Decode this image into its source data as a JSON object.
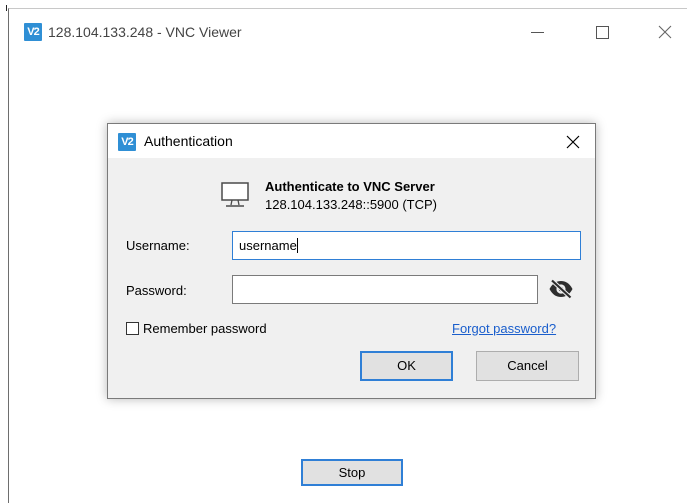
{
  "window": {
    "title": "128.104.133.248 - VNC Viewer",
    "logo_text": "V2"
  },
  "dialog": {
    "title": "Authentication",
    "logo_text": "V2",
    "heading": "Authenticate to VNC Server",
    "server_address": "128.104.133.248::5900 (TCP)",
    "username_label": "Username:",
    "username_value": "username",
    "password_label": "Password:",
    "password_value": "",
    "remember_label": "Remember password",
    "remember_checked": false,
    "forgot_link": "Forgot password?",
    "ok_label": "OK",
    "cancel_label": "Cancel"
  },
  "footer": {
    "stop_label": "Stop"
  },
  "icons": {
    "logo": "vnc-logo-icon",
    "monitor": "monitor-icon",
    "toggle_visibility": "eye-slash-icon",
    "close": "close-icon"
  },
  "colors": {
    "brand": "#2f8fd5",
    "focus": "#2f7fd6",
    "link": "#1a5ecc",
    "dialog_bg": "#f0f0f0"
  }
}
